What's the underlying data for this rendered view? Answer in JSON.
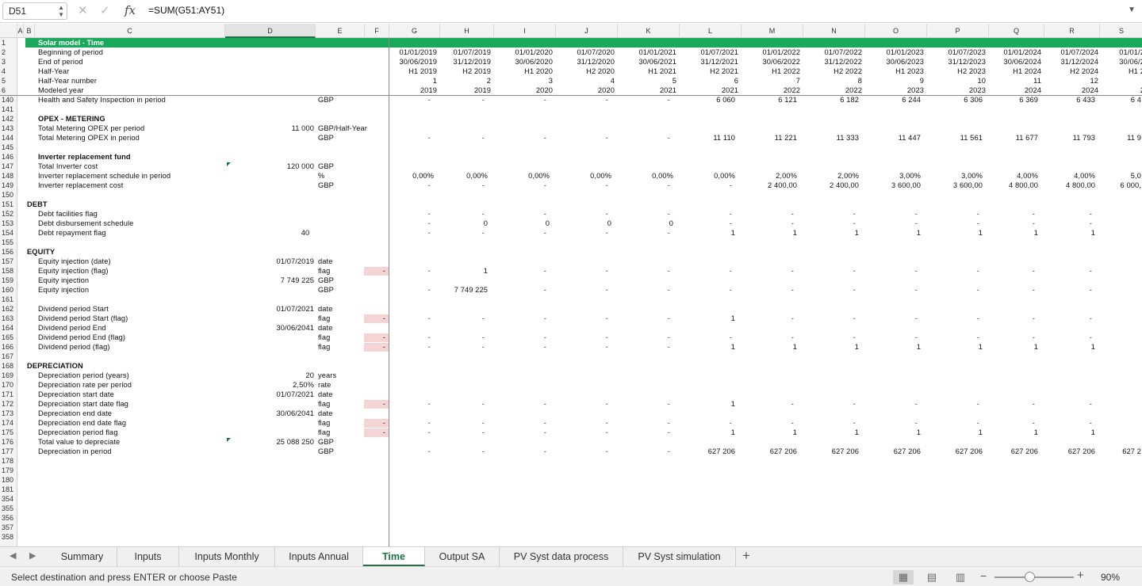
{
  "formula_bar": {
    "name_box": "D51",
    "formula": "=SUM(G51:AY51)"
  },
  "column_headers": [
    "A",
    "B",
    "C",
    "D",
    "E",
    "F",
    "G",
    "H",
    "I",
    "J",
    "K",
    "L",
    "M",
    "N",
    "O",
    "P",
    "Q",
    "R",
    "S"
  ],
  "header_section": {
    "title": "Solar model - Time",
    "labels": [
      "Beginning of period",
      "End of period",
      "Half-Year",
      "Half-Year number",
      "Modeled year"
    ],
    "periods": [
      {
        "begin": "01/01/2019",
        "end": "30/06/2019",
        "half": "H1 2019",
        "num": "1",
        "year": "2019"
      },
      {
        "begin": "01/07/2019",
        "end": "31/12/2019",
        "half": "H2 2019",
        "num": "2",
        "year": "2019"
      },
      {
        "begin": "01/01/2020",
        "end": "30/06/2020",
        "half": "H1 2020",
        "num": "3",
        "year": "2020"
      },
      {
        "begin": "01/07/2020",
        "end": "31/12/2020",
        "half": "H2 2020",
        "num": "4",
        "year": "2020"
      },
      {
        "begin": "01/01/2021",
        "end": "30/06/2021",
        "half": "H1 2021",
        "num": "5",
        "year": "2021"
      },
      {
        "begin": "01/07/2021",
        "end": "31/12/2021",
        "half": "H2 2021",
        "num": "6",
        "year": "2021"
      },
      {
        "begin": "01/01/2022",
        "end": "30/06/2022",
        "half": "H1 2022",
        "num": "7",
        "year": "2022"
      },
      {
        "begin": "01/07/2022",
        "end": "31/12/2022",
        "half": "H2 2022",
        "num": "8",
        "year": "2022"
      },
      {
        "begin": "01/01/2023",
        "end": "30/06/2023",
        "half": "H1 2023",
        "num": "9",
        "year": "2023"
      },
      {
        "begin": "01/07/2023",
        "end": "31/12/2023",
        "half": "H2 2023",
        "num": "10",
        "year": "2023"
      },
      {
        "begin": "01/01/2024",
        "end": "30/06/2024",
        "half": "H1 2024",
        "num": "11",
        "year": "2024"
      },
      {
        "begin": "01/07/2024",
        "end": "31/12/2024",
        "half": "H2 2024",
        "num": "12",
        "year": "2024"
      },
      {
        "begin": "01/01/2",
        "end": "30/06/2",
        "half": "H1 2",
        "num": "",
        "year": "2"
      }
    ]
  },
  "row_numbers": [
    "1",
    "2",
    "3",
    "4",
    "5",
    "6",
    "140",
    "141",
    "142",
    "143",
    "144",
    "145",
    "146",
    "147",
    "148",
    "149",
    "150",
    "151",
    "152",
    "153",
    "154",
    "155",
    "156",
    "157",
    "158",
    "159",
    "160",
    "161",
    "162",
    "163",
    "164",
    "165",
    "166",
    "167",
    "168",
    "169",
    "170",
    "171",
    "172",
    "173",
    "174",
    "175",
    "176",
    "177",
    "178",
    "179",
    "180",
    "181",
    "354",
    "355",
    "356",
    "357",
    "358"
  ],
  "rows": [
    {
      "label": "Health and Safety Inspection in period",
      "unit": "GBP",
      "vals": [
        "-",
        "-",
        "-",
        "-",
        "-",
        "6 060",
        "6 121",
        "6 182",
        "6 244",
        "6 306",
        "6 369",
        "6 433",
        "6 4"
      ]
    },
    {},
    {
      "label": "OPEX - METERING",
      "bold": true,
      "indent": 1
    },
    {
      "label": "Total Metering OPEX per period",
      "d": "11 000",
      "unit": "GBP/Half-Year"
    },
    {
      "label": "Total Metering OPEX in period",
      "unit": "GBP",
      "vals": [
        "-",
        "-",
        "-",
        "-",
        "-",
        "11 110",
        "11 221",
        "11 333",
        "11 447",
        "11 561",
        "11 677",
        "11 793",
        "11 9"
      ]
    },
    {},
    {
      "label": "Inverter replacement fund",
      "bold": true,
      "indent": 1
    },
    {
      "label": "Total Inverter cost",
      "d": "120 000",
      "unit": "GBP",
      "tri": true
    },
    {
      "label": "Inverter replacement schedule in period",
      "unit": "%",
      "vals": [
        "0,00%",
        "0,00%",
        "0,00%",
        "0,00%",
        "0,00%",
        "0,00%",
        "2,00%",
        "2,00%",
        "3,00%",
        "3,00%",
        "4,00%",
        "4,00%",
        "5,0"
      ]
    },
    {
      "label": "Inverter replacement cost",
      "unit": "GBP",
      "vals": [
        "-",
        "-",
        "-",
        "-",
        "-",
        "-",
        "2 400,00",
        "2 400,00",
        "3 600,00",
        "3 600,00",
        "4 800,00",
        "4 800,00",
        "6 000,"
      ]
    },
    {},
    {
      "label": "DEBT",
      "bold": true,
      "indent": 0
    },
    {
      "label": "Debt facilities flag",
      "vals": [
        "-",
        "-",
        "-",
        "-",
        "-",
        "-",
        "-",
        "-",
        "-",
        "-",
        "-",
        "-",
        ""
      ]
    },
    {
      "label": "Debt disbursement schedule",
      "vals": [
        "-",
        "0",
        "0",
        "0",
        "0",
        "-",
        "-",
        "-",
        "-",
        "-",
        "-",
        "-",
        ""
      ]
    },
    {
      "label": "Debt repayment flag",
      "d": "40",
      "dc": true,
      "vals": [
        "-",
        "-",
        "-",
        "-",
        "-",
        "1",
        "1",
        "1",
        "1",
        "1",
        "1",
        "1",
        ""
      ]
    },
    {},
    {
      "label": "EQUITY",
      "bold": true,
      "indent": 0
    },
    {
      "label": "Equity injection (date)",
      "d": "01/07/2019",
      "unit": "date"
    },
    {
      "label": "Equity injection (flag)",
      "unit": "flag",
      "pink": "-",
      "vals": [
        "-",
        "1",
        "-",
        "-",
        "-",
        "-",
        "-",
        "-",
        "-",
        "-",
        "-",
        "-",
        ""
      ]
    },
    {
      "label": "Equity injection",
      "d": "7 749 225",
      "unit": "GBP"
    },
    {
      "label": "Equity injection",
      "unit": "GBP",
      "vals": [
        "-",
        "7 749 225",
        "-",
        "-",
        "-",
        "-",
        "-",
        "-",
        "-",
        "-",
        "-",
        "-",
        ""
      ]
    },
    {},
    {
      "label": "Dividend period Start",
      "d": "01/07/2021",
      "unit": "date"
    },
    {
      "label": "Dividend period Start (flag)",
      "unit": "flag",
      "pink": "-",
      "vals": [
        "-",
        "-",
        "-",
        "-",
        "-",
        "1",
        "-",
        "-",
        "-",
        "-",
        "-",
        "-",
        ""
      ]
    },
    {
      "label": "Dividend period End",
      "d": "30/06/2041",
      "unit": "date"
    },
    {
      "label": "Dividend period End (flag)",
      "unit": "flag",
      "pink": "-",
      "vals": [
        "-",
        "-",
        "-",
        "-",
        "-",
        "-",
        "-",
        "-",
        "-",
        "-",
        "-",
        "-",
        ""
      ]
    },
    {
      "label": "Dividend period (flag)",
      "unit": "flag",
      "pink": "-",
      "vals": [
        "-",
        "-",
        "-",
        "-",
        "-",
        "1",
        "1",
        "1",
        "1",
        "1",
        "1",
        "1",
        ""
      ]
    },
    {},
    {
      "label": "DEPRECIATION",
      "bold": true,
      "indent": 0
    },
    {
      "label": "Depreciation period (years)",
      "d": "20",
      "unit": "years"
    },
    {
      "label": "Depreciation rate per period",
      "d": "2,50%",
      "unit": "rate"
    },
    {
      "label": "Depreciation start date",
      "d": "01/07/2021",
      "unit": "date"
    },
    {
      "label": "Depreciation start date flag",
      "unit": "flag",
      "pink": "-",
      "vals": [
        "-",
        "-",
        "-",
        "-",
        "-",
        "1",
        "-",
        "-",
        "-",
        "-",
        "-",
        "-",
        ""
      ]
    },
    {
      "label": "Depreciation end date",
      "d": "30/06/2041",
      "unit": "date"
    },
    {
      "label": "Depreciation end date flag",
      "unit": "flag",
      "pink": "-",
      "vals": [
        "-",
        "-",
        "-",
        "-",
        "-",
        "-",
        "-",
        "-",
        "-",
        "-",
        "-",
        "-",
        ""
      ]
    },
    {
      "label": "Depreciation period flag",
      "unit": "flag",
      "pink": "-",
      "vals": [
        "-",
        "-",
        "-",
        "-",
        "-",
        "1",
        "1",
        "1",
        "1",
        "1",
        "1",
        "1",
        ""
      ]
    },
    {
      "label": "Total value to depreciate",
      "d": "25 088 250",
      "unit": "GBP",
      "tri": true
    },
    {
      "label": "Depreciation in period",
      "unit": "GBP",
      "vals": [
        "-",
        "-",
        "-",
        "-",
        "-",
        "627 206",
        "627 206",
        "627 206",
        "627 206",
        "627 206",
        "627 206",
        "627 206",
        "627 2"
      ]
    }
  ],
  "tabs": [
    "Summary",
    "Inputs",
    "Inputs Monthly",
    "Inputs Annual",
    "Time",
    "Output SA",
    "PV Syst data process",
    "PV Syst simulation"
  ],
  "active_tab": "Time",
  "status": {
    "message": "Select destination and press ENTER or choose Paste",
    "zoom": "90%"
  },
  "colors": {
    "accent": "#1e7145",
    "title_bar": "#1aa95a",
    "flag_fill": "#f4d4d4"
  }
}
